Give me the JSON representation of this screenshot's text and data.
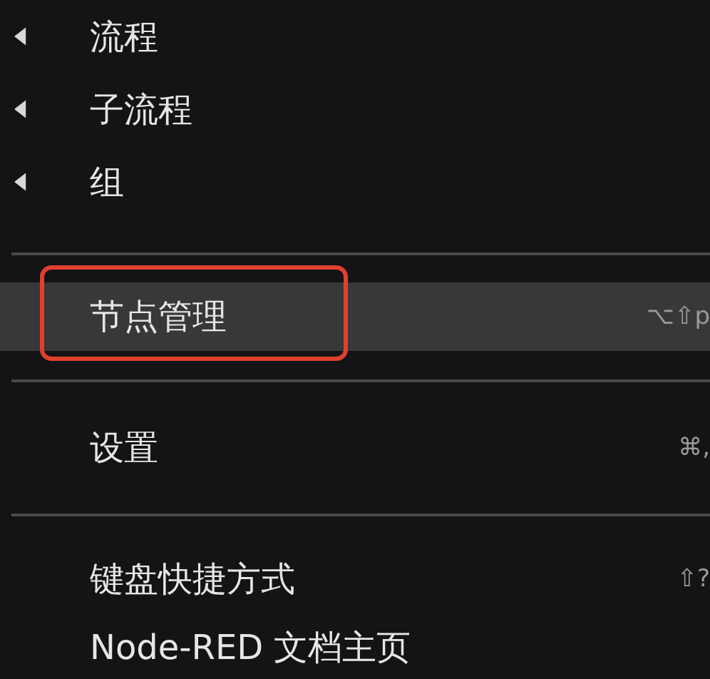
{
  "menu": {
    "items": [
      {
        "kind": "submenu",
        "label": "流程"
      },
      {
        "kind": "submenu",
        "label": "子流程"
      },
      {
        "kind": "submenu",
        "label": "组"
      },
      {
        "kind": "divider"
      },
      {
        "kind": "item",
        "label": "节点管理",
        "shortcut": "⌥⇧p",
        "selected": true,
        "callout": true
      },
      {
        "kind": "divider"
      },
      {
        "kind": "item",
        "label": "设置",
        "shortcut": "⌘,",
        "selected": false,
        "callout": false
      },
      {
        "kind": "divider"
      },
      {
        "kind": "item",
        "label": "键盘快捷方式",
        "shortcut": "⇧?",
        "selected": false,
        "callout": false
      },
      {
        "kind": "item",
        "label": "Node-RED 文档主页",
        "selected": false,
        "callout": false
      }
    ]
  }
}
